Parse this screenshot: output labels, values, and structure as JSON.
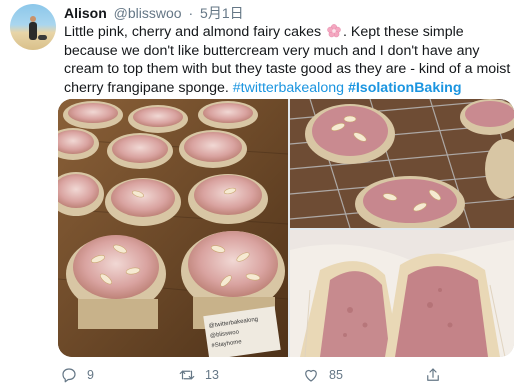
{
  "author": {
    "name": "Alison",
    "handle": "@blisswoo",
    "separator": "·",
    "date": "5月1日"
  },
  "tweet": {
    "text_part1": "Little pink, cherry and almond fairy cakes",
    "text_part2": ". Kept these simple because we don't like buttercream very much and I don't have any cream to top them with but they taste good as they are - kind of a moist cherry frangipane sponge.",
    "hashtag1": "#twitterbakealong",
    "hashtag2": "#IsolationBaking",
    "emoji": "cherry-blossom-icon"
  },
  "media": {
    "image_count": 3,
    "note_text": "@twitterbakealong @blisswoo #Stayhome"
  },
  "actions": {
    "reply_count": "9",
    "retweet_count": "13",
    "like_count": "85"
  },
  "colors": {
    "link": "#1b95e0",
    "muted": "#657786",
    "text": "#14171a"
  }
}
